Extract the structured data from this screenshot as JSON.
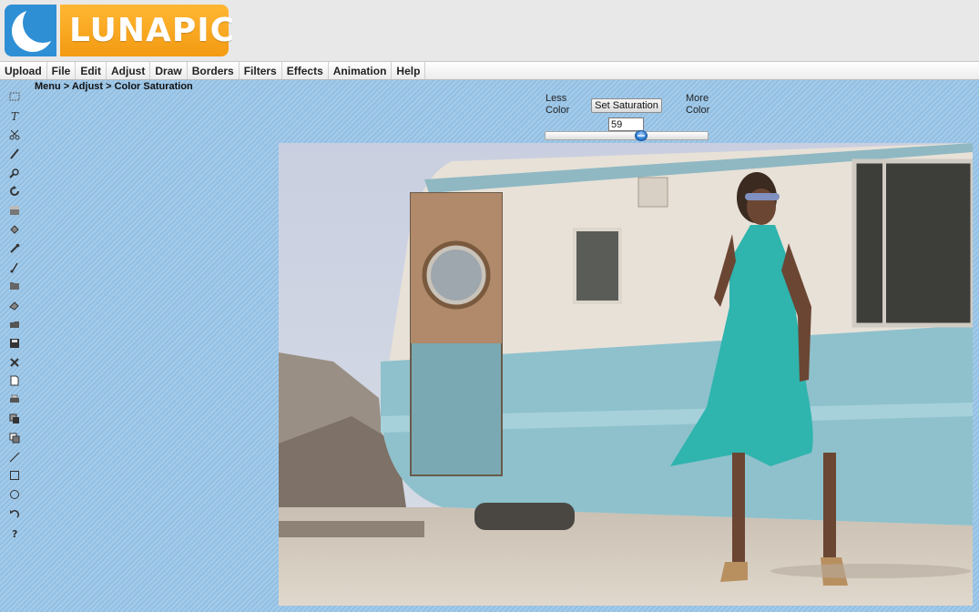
{
  "app": {
    "logo_text": "LUNAPIC",
    "brand_colors": {
      "logo_blue": "#2e8fd4",
      "logo_orange": "#f5a21a",
      "background": "#9cc5e6"
    }
  },
  "menu": {
    "items": [
      "Upload",
      "File",
      "Edit",
      "Adjust",
      "Draw",
      "Borders",
      "Filters",
      "Effects",
      "Animation",
      "Help"
    ]
  },
  "breadcrumb": "Menu > Adjust > Color Saturation",
  "toolbar": {
    "tools": [
      "select-icon",
      "text-icon",
      "scissors-icon",
      "pencil-icon",
      "zoom-icon",
      "rotate-icon",
      "gradient-icon",
      "fill-icon",
      "eyedropper-icon",
      "brush-icon",
      "folder-icon",
      "eraser-icon",
      "open-icon",
      "save-icon",
      "close-icon",
      "new-document-icon",
      "print-icon",
      "layers-icon",
      "copy-icon",
      "line-icon",
      "rectangle-icon",
      "circle-icon",
      "undo-icon",
      "help-icon"
    ]
  },
  "saturation": {
    "less_label": "Less Color",
    "more_label": "More Color",
    "button_label": "Set Saturation",
    "value": "59",
    "slider_fraction": 0.59
  },
  "canvas": {
    "description_icon": "photo-image"
  }
}
